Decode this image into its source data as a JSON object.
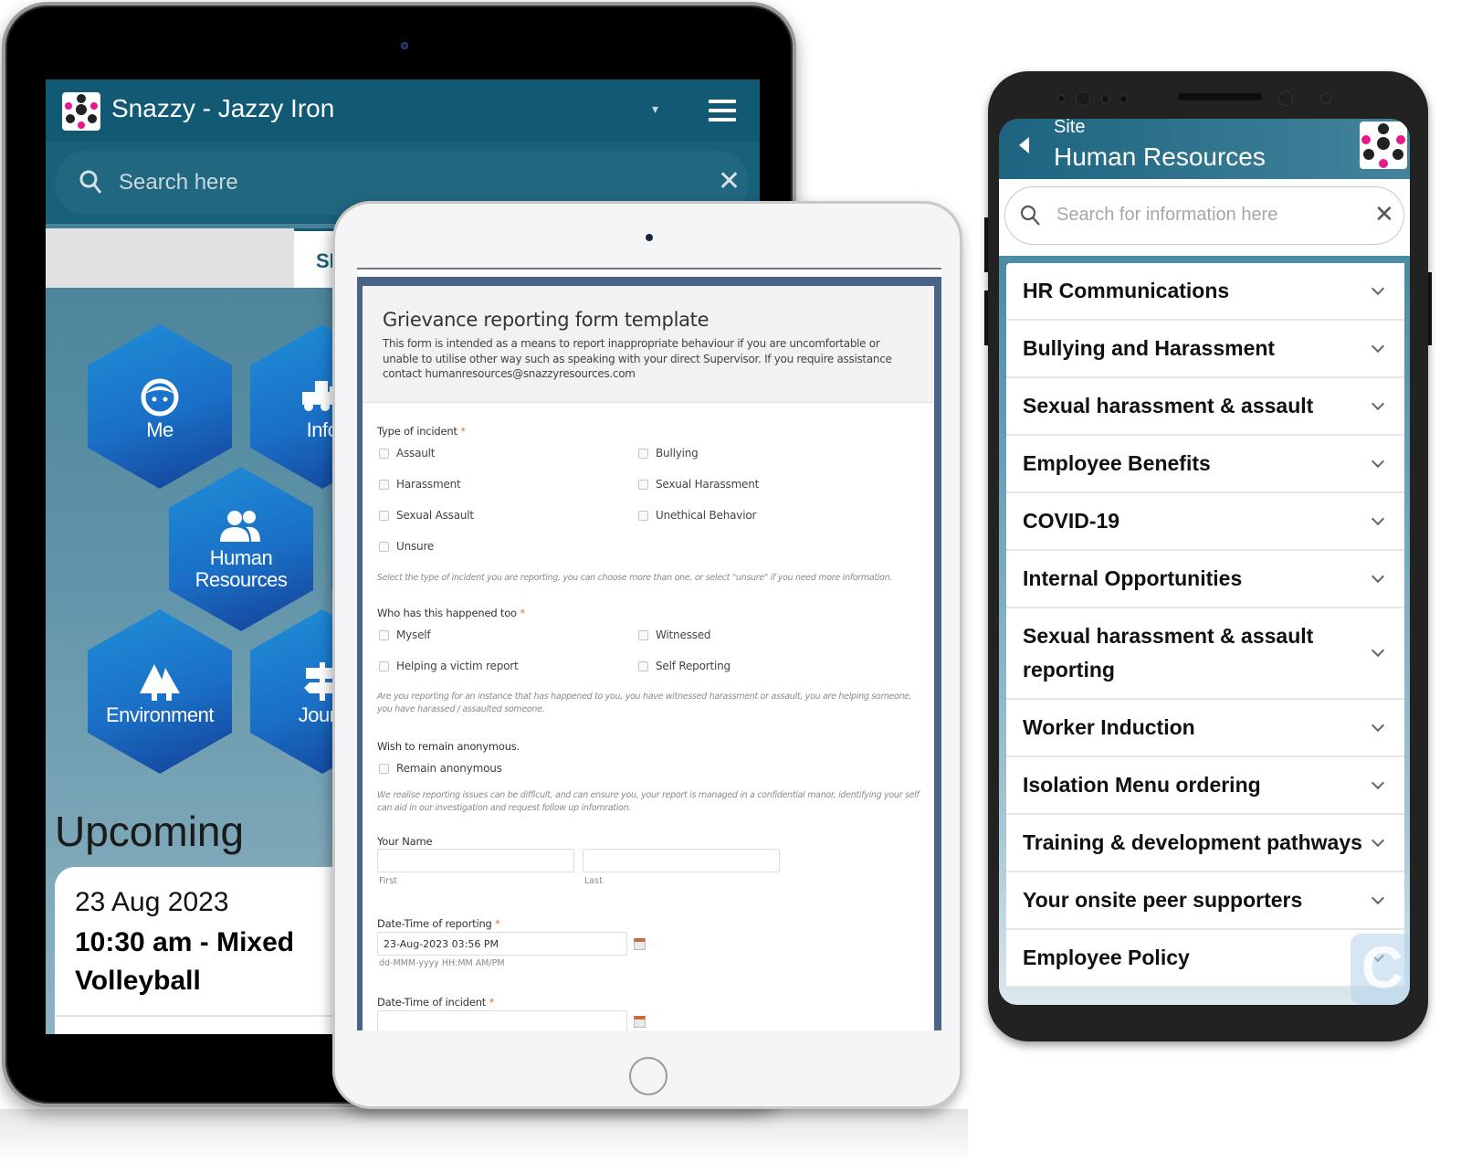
{
  "tablet_large": {
    "header": {
      "title": "Snazzy - Jazzy Iron",
      "caret": "▾"
    },
    "search": {
      "placeholder": "Search here",
      "clear": "✕"
    },
    "tab_active_label": "SI",
    "tiles": [
      {
        "label": "Me",
        "icon": "face-icon"
      },
      {
        "label": "Info",
        "icon": "truck-icon"
      },
      {
        "label": "Human Resources",
        "icon": "people-icon"
      },
      {
        "label": "Environment",
        "icon": "trees-icon"
      },
      {
        "label": "Journ",
        "icon": "signpost-icon"
      }
    ],
    "upcoming_heading": "Upcoming",
    "event": {
      "date": "23 Aug 2023",
      "title": "10:30 am - Mixed Volleyball"
    }
  },
  "tablet_form": {
    "title": "Grievance reporting form template",
    "description": "This form is intended as a means to report inappropriate behaviour if you are uncomfortable or unable to utilise other way such as speaking with your direct Supervisor. If you require assistance contact humanresources@snazzyresources.com",
    "required_mark": "*",
    "incident_type": {
      "label": "Type of incident",
      "options": [
        "Assault",
        "Bullying",
        "Harassment",
        "Sexual Harassment",
        "Sexual Assault",
        "Unethical Behavior",
        "Unsure"
      ],
      "hint": "Select the type of incident you are reporting, you can choose more than one, or select \"unsure\" if you need more information."
    },
    "who": {
      "label": "Who has this happened too",
      "options": [
        "Myself",
        "Witnessed",
        "Helping a victim report",
        "Self Reporting"
      ],
      "hint": "Are you reporting for an instance that has happened to you, you have witnessed harassment or assault, you are helping someone, you have harassed / assaulted someone."
    },
    "anonymous": {
      "label": "Wish to remain anonymous.",
      "option": "Remain anonymous",
      "hint": "We realise reporting issues can be difficult, and can ensure you, your report is managed in a confidential manor, identifying your self can aid in our investigation and request follow up infomration."
    },
    "name": {
      "label": "Your Name",
      "first_value": "",
      "last_value": "",
      "first_sub": "First",
      "last_sub": "Last"
    },
    "date_reporting": {
      "label": "Date-Time of reporting",
      "value": "23-Aug-2023 03:56 PM",
      "format_hint": "dd-MMM-yyyy HH:MM AM/PM"
    },
    "date_incident": {
      "label": "Date-Time of incident",
      "value": ""
    }
  },
  "phone": {
    "header": {
      "site_label": "Site",
      "title": "Human Resources"
    },
    "search": {
      "placeholder": "Search for information here",
      "clear": "✕"
    },
    "menu": [
      "HR Communications",
      "Bullying and Harassment",
      "Sexual harassment & assault",
      "Employee Benefits",
      "COVID-19",
      "Internal Opportunities",
      "Sexual harassment & assault reporting",
      "Worker Induction",
      "Isolation Menu ordering",
      "Training & development pathways",
      "Your onsite peer supporters",
      "Employee Policy"
    ],
    "badge_glyph": "C"
  },
  "colors": {
    "header_teal": "#125a74",
    "tile_blue": "#1a6fc6",
    "form_frame": "#4a6488",
    "required": "#e0752a",
    "logo_pink": "#e8178a"
  }
}
